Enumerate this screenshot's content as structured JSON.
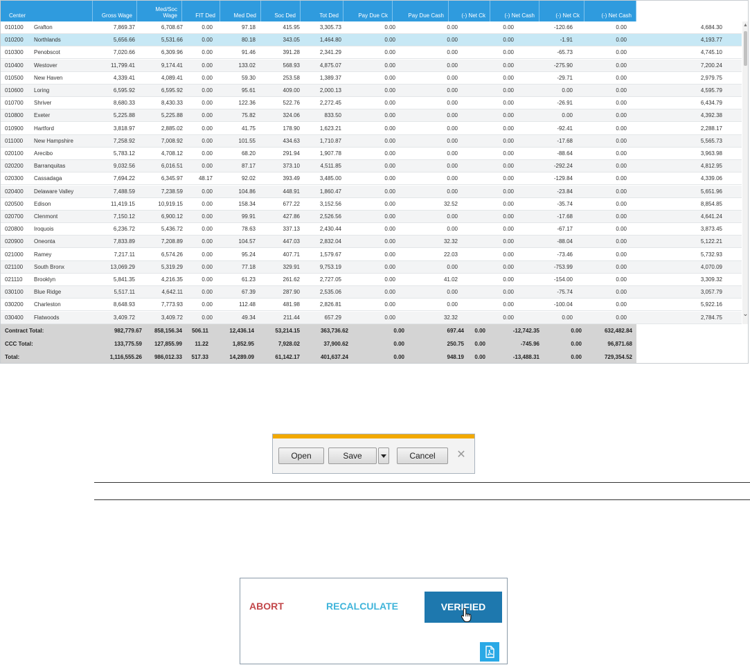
{
  "grid": {
    "headers": [
      "Center",
      "Gross Wage",
      "Med/Soc\nWage",
      "FIT Ded",
      "Med Ded",
      "Soc Ded",
      "Tot Ded",
      "Pay Due Ck",
      "Pay Due Cash",
      "(-) Net Ck",
      "(-) Net Cash",
      "(-) Net Ck",
      "(-) Net Cash"
    ],
    "rows": [
      {
        "code": "010100",
        "name": "Grafton",
        "values": [
          "7,869.37",
          "6,708.67",
          "0.00",
          "97.18",
          "415.95",
          "3,305.73",
          "0.00",
          "0.00",
          "0.00",
          "-120.66",
          "0.00",
          "4,684.30"
        ]
      },
      {
        "code": "010200",
        "name": "Northlands",
        "values": [
          "5,656.66",
          "5,531.66",
          "0.00",
          "80.18",
          "343.05",
          "1,464.80",
          "0.00",
          "0.00",
          "0.00",
          "-1.91",
          "0.00",
          "4,193.77"
        ]
      },
      {
        "code": "010300",
        "name": "Penobscot",
        "values": [
          "7,020.66",
          "6,309.96",
          "0.00",
          "91.46",
          "391.28",
          "2,341.29",
          "0.00",
          "0.00",
          "0.00",
          "-65.73",
          "0.00",
          "4,745.10"
        ]
      },
      {
        "code": "010400",
        "name": "Westover",
        "values": [
          "11,799.41",
          "9,174.41",
          "0.00",
          "133.02",
          "568.93",
          "4,875.07",
          "0.00",
          "0.00",
          "0.00",
          "-275.90",
          "0.00",
          "7,200.24"
        ]
      },
      {
        "code": "010500",
        "name": "New Haven",
        "values": [
          "4,339.41",
          "4,089.41",
          "0.00",
          "59.30",
          "253.58",
          "1,389.37",
          "0.00",
          "0.00",
          "0.00",
          "-29.71",
          "0.00",
          "2,979.75"
        ]
      },
      {
        "code": "010600",
        "name": "Loring",
        "values": [
          "6,595.92",
          "6,595.92",
          "0.00",
          "95.61",
          "409.00",
          "2,000.13",
          "0.00",
          "0.00",
          "0.00",
          "0.00",
          "0.00",
          "4,595.79"
        ]
      },
      {
        "code": "010700",
        "name": "Shriver",
        "values": [
          "8,680.33",
          "8,430.33",
          "0.00",
          "122.36",
          "522.76",
          "2,272.45",
          "0.00",
          "0.00",
          "0.00",
          "-26.91",
          "0.00",
          "6,434.79"
        ]
      },
      {
        "code": "010800",
        "name": "Exeter",
        "values": [
          "5,225.88",
          "5,225.88",
          "0.00",
          "75.82",
          "324.06",
          "833.50",
          "0.00",
          "0.00",
          "0.00",
          "0.00",
          "0.00",
          "4,392.38"
        ]
      },
      {
        "code": "010900",
        "name": "Hartford",
        "values": [
          "3,818.97",
          "2,885.02",
          "0.00",
          "41.75",
          "178.90",
          "1,623.21",
          "0.00",
          "0.00",
          "0.00",
          "-92.41",
          "0.00",
          "2,288.17"
        ]
      },
      {
        "code": "011000",
        "name": "New Hampshire",
        "values": [
          "7,258.92",
          "7,008.92",
          "0.00",
          "101.55",
          "434.63",
          "1,710.87",
          "0.00",
          "0.00",
          "0.00",
          "-17.68",
          "0.00",
          "5,565.73"
        ]
      },
      {
        "code": "020100",
        "name": "Arecibo",
        "values": [
          "5,783.12",
          "4,708.12",
          "0.00",
          "68.20",
          "291.94",
          "1,907.78",
          "0.00",
          "0.00",
          "0.00",
          "-88.64",
          "0.00",
          "3,963.98"
        ]
      },
      {
        "code": "020200",
        "name": "Barranquitas",
        "values": [
          "9,032.56",
          "6,016.51",
          "0.00",
          "87.17",
          "373.10",
          "4,511.85",
          "0.00",
          "0.00",
          "0.00",
          "-292.24",
          "0.00",
          "4,812.95"
        ]
      },
      {
        "code": "020300",
        "name": "Cassadaga",
        "values": [
          "7,694.22",
          "6,345.97",
          "48.17",
          "92.02",
          "393.49",
          "3,485.00",
          "0.00",
          "0.00",
          "0.00",
          "-129.84",
          "0.00",
          "4,339.06"
        ]
      },
      {
        "code": "020400",
        "name": "Delaware Valley",
        "values": [
          "7,488.59",
          "7,238.59",
          "0.00",
          "104.86",
          "448.91",
          "1,860.47",
          "0.00",
          "0.00",
          "0.00",
          "-23.84",
          "0.00",
          "5,651.96"
        ]
      },
      {
        "code": "020500",
        "name": "Edison",
        "values": [
          "11,419.15",
          "10,919.15",
          "0.00",
          "158.34",
          "677.22",
          "3,152.56",
          "0.00",
          "32.52",
          "0.00",
          "-35.74",
          "0.00",
          "8,854.85"
        ]
      },
      {
        "code": "020700",
        "name": "Clenmont",
        "values": [
          "7,150.12",
          "6,900.12",
          "0.00",
          "99.91",
          "427.86",
          "2,526.56",
          "0.00",
          "0.00",
          "0.00",
          "-17.68",
          "0.00",
          "4,641.24"
        ]
      },
      {
        "code": "020800",
        "name": "Iroquois",
        "values": [
          "6,236.72",
          "5,436.72",
          "0.00",
          "78.63",
          "337.13",
          "2,430.44",
          "0.00",
          "0.00",
          "0.00",
          "-67.17",
          "0.00",
          "3,873.45"
        ]
      },
      {
        "code": "020900",
        "name": "Oneonta",
        "values": [
          "7,833.89",
          "7,208.89",
          "0.00",
          "104.57",
          "447.03",
          "2,832.04",
          "0.00",
          "32.32",
          "0.00",
          "-88.04",
          "0.00",
          "5,122.21"
        ]
      },
      {
        "code": "021000",
        "name": "Ramey",
        "values": [
          "7,217.11",
          "6,574.26",
          "0.00",
          "95.24",
          "407.71",
          "1,579.67",
          "0.00",
          "22.03",
          "0.00",
          "-73.46",
          "0.00",
          "5,732.93"
        ]
      },
      {
        "code": "021100",
        "name": "South Bronx",
        "values": [
          "13,069.29",
          "5,319.29",
          "0.00",
          "77.18",
          "329.91",
          "9,753.19",
          "0.00",
          "0.00",
          "0.00",
          "-753.99",
          "0.00",
          "4,070.09"
        ]
      },
      {
        "code": "021110",
        "name": "Brooklyn",
        "values": [
          "5,841.35",
          "4,216.35",
          "0.00",
          "61.23",
          "261.62",
          "2,727.05",
          "0.00",
          "41.02",
          "0.00",
          "-154.00",
          "0.00",
          "3,309.32"
        ]
      },
      {
        "code": "030100",
        "name": "Blue Ridge",
        "values": [
          "5,517.11",
          "4,642.11",
          "0.00",
          "67.39",
          "287.90",
          "2,535.06",
          "0.00",
          "0.00",
          "0.00",
          "-75.74",
          "0.00",
          "3,057.79"
        ]
      },
      {
        "code": "030200",
        "name": "Charleston",
        "values": [
          "8,648.93",
          "7,773.93",
          "0.00",
          "112.48",
          "481.98",
          "2,826.81",
          "0.00",
          "0.00",
          "0.00",
          "-100.04",
          "0.00",
          "5,922.16"
        ]
      },
      {
        "code": "030400",
        "name": "Flatwoods",
        "values": [
          "3,409.72",
          "3,409.72",
          "0.00",
          "49.34",
          "211.44",
          "657.29",
          "0.00",
          "32.32",
          "0.00",
          "0.00",
          "0.00",
          "2,784.75"
        ]
      }
    ],
    "selected_index": 1,
    "totals": [
      {
        "label": "Contract Total:",
        "values": [
          "982,779.67",
          "858,156.34",
          "506.11",
          "12,436.14",
          "53,214.15",
          "363,736.62",
          "0.00",
          "697.44",
          "0.00",
          "-12,742.35",
          "0.00",
          "632,482.84"
        ]
      },
      {
        "label": "CCC Total:",
        "values": [
          "133,775.59",
          "127,855.99",
          "11.22",
          "1,852.95",
          "7,928.02",
          "37,900.62",
          "0.00",
          "250.75",
          "0.00",
          "-745.96",
          "0.00",
          "96,871.68"
        ]
      },
      {
        "label": "Total:",
        "values": [
          "1,116,555.26",
          "986,012.33",
          "517.33",
          "14,289.09",
          "61,142.17",
          "401,637.24",
          "0.00",
          "948.19",
          "0.00",
          "-13,488.31",
          "0.00",
          "729,354.52"
        ]
      }
    ]
  },
  "dialog": {
    "open_label": "Open",
    "save_label": "Save",
    "cancel_label": "Cancel",
    "close_glyph": "✕"
  },
  "actions": {
    "abort_label": "ABORT",
    "recalculate_label": "RECALCULATE",
    "verified_label": "VERIFIED",
    "pdf_icon": "pdf-icon"
  },
  "colors": {
    "header_blue": "#2f9bde",
    "selected_row": "#c7e8f5",
    "totals_gray": "#d4d4d4",
    "dialog_accent": "#f2a900",
    "abort_red": "#c2474a",
    "recalc_blue": "#3fb4da",
    "verified_blue": "#1e78ae",
    "pdf_blue": "#2aa9e6"
  }
}
